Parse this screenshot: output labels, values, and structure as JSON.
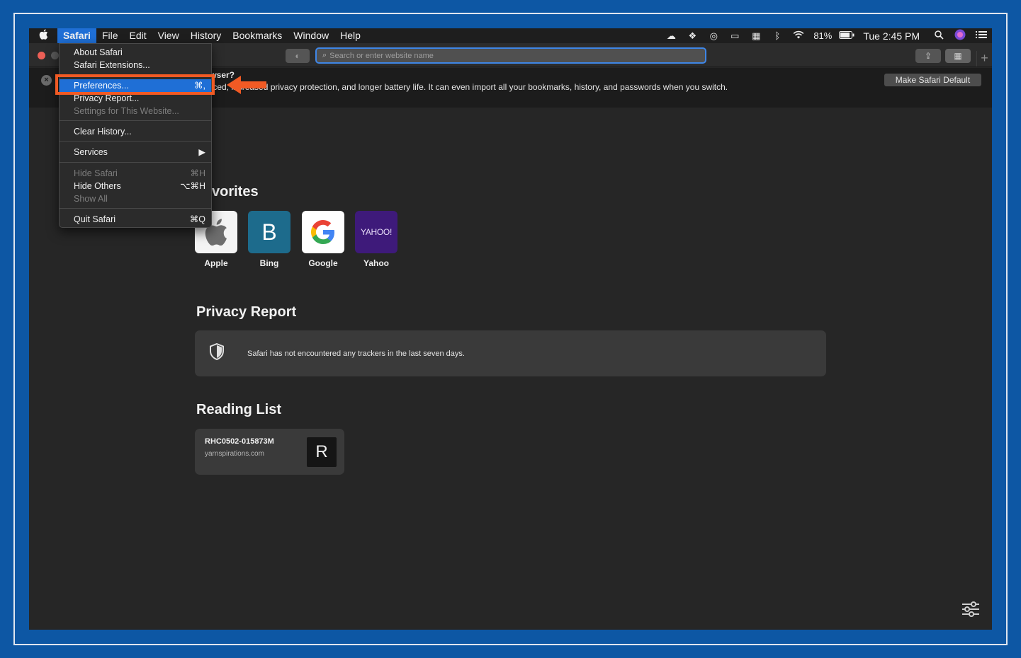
{
  "menubar": {
    "items": [
      {
        "label": "Safari",
        "active": true
      },
      {
        "label": "File"
      },
      {
        "label": "Edit"
      },
      {
        "label": "View"
      },
      {
        "label": "History"
      },
      {
        "label": "Bookmarks"
      },
      {
        "label": "Window"
      },
      {
        "label": "Help"
      }
    ],
    "battery": "81%",
    "clock": "Tue 2:45 PM"
  },
  "toolbar": {
    "address_placeholder": "Search or enter website name"
  },
  "banner": {
    "title": "browser?",
    "text": "manced, increased privacy protection, and longer battery life. It can even import all your bookmarks, history, and passwords when you switch.",
    "make_default_label": "Make Safari Default"
  },
  "dropdown": {
    "about": "About Safari",
    "extensions": "Safari Extensions...",
    "preferences": "Preferences...",
    "preferences_shortcut": "⌘,",
    "privacy_report": "Privacy Report...",
    "settings_site": "Settings for This Website...",
    "clear_history": "Clear History...",
    "services": "Services",
    "hide_safari": "Hide Safari",
    "hide_safari_shortcut": "⌘H",
    "hide_others": "Hide Others",
    "hide_others_shortcut": "⌥⌘H",
    "show_all": "Show All",
    "quit": "Quit Safari",
    "quit_shortcut": "⌘Q"
  },
  "favorites": {
    "title": "vorites",
    "items": [
      {
        "label": "Apple"
      },
      {
        "label": "Bing",
        "letter": "B"
      },
      {
        "label": "Google"
      },
      {
        "label": "Yahoo",
        "logo_text": "YAHOO!"
      }
    ]
  },
  "privacy_report": {
    "title": "Privacy Report",
    "message": "Safari has not encountered any trackers in the last seven days."
  },
  "reading_list": {
    "title": "Reading List",
    "items": [
      {
        "title": "RHC0502-015873M",
        "site": "yarnspirations.com",
        "thumb_letter": "R"
      }
    ]
  },
  "colors": {
    "accent": "#1f6fd6",
    "annotation": "#f15a24",
    "frame": "#0d57a4"
  }
}
